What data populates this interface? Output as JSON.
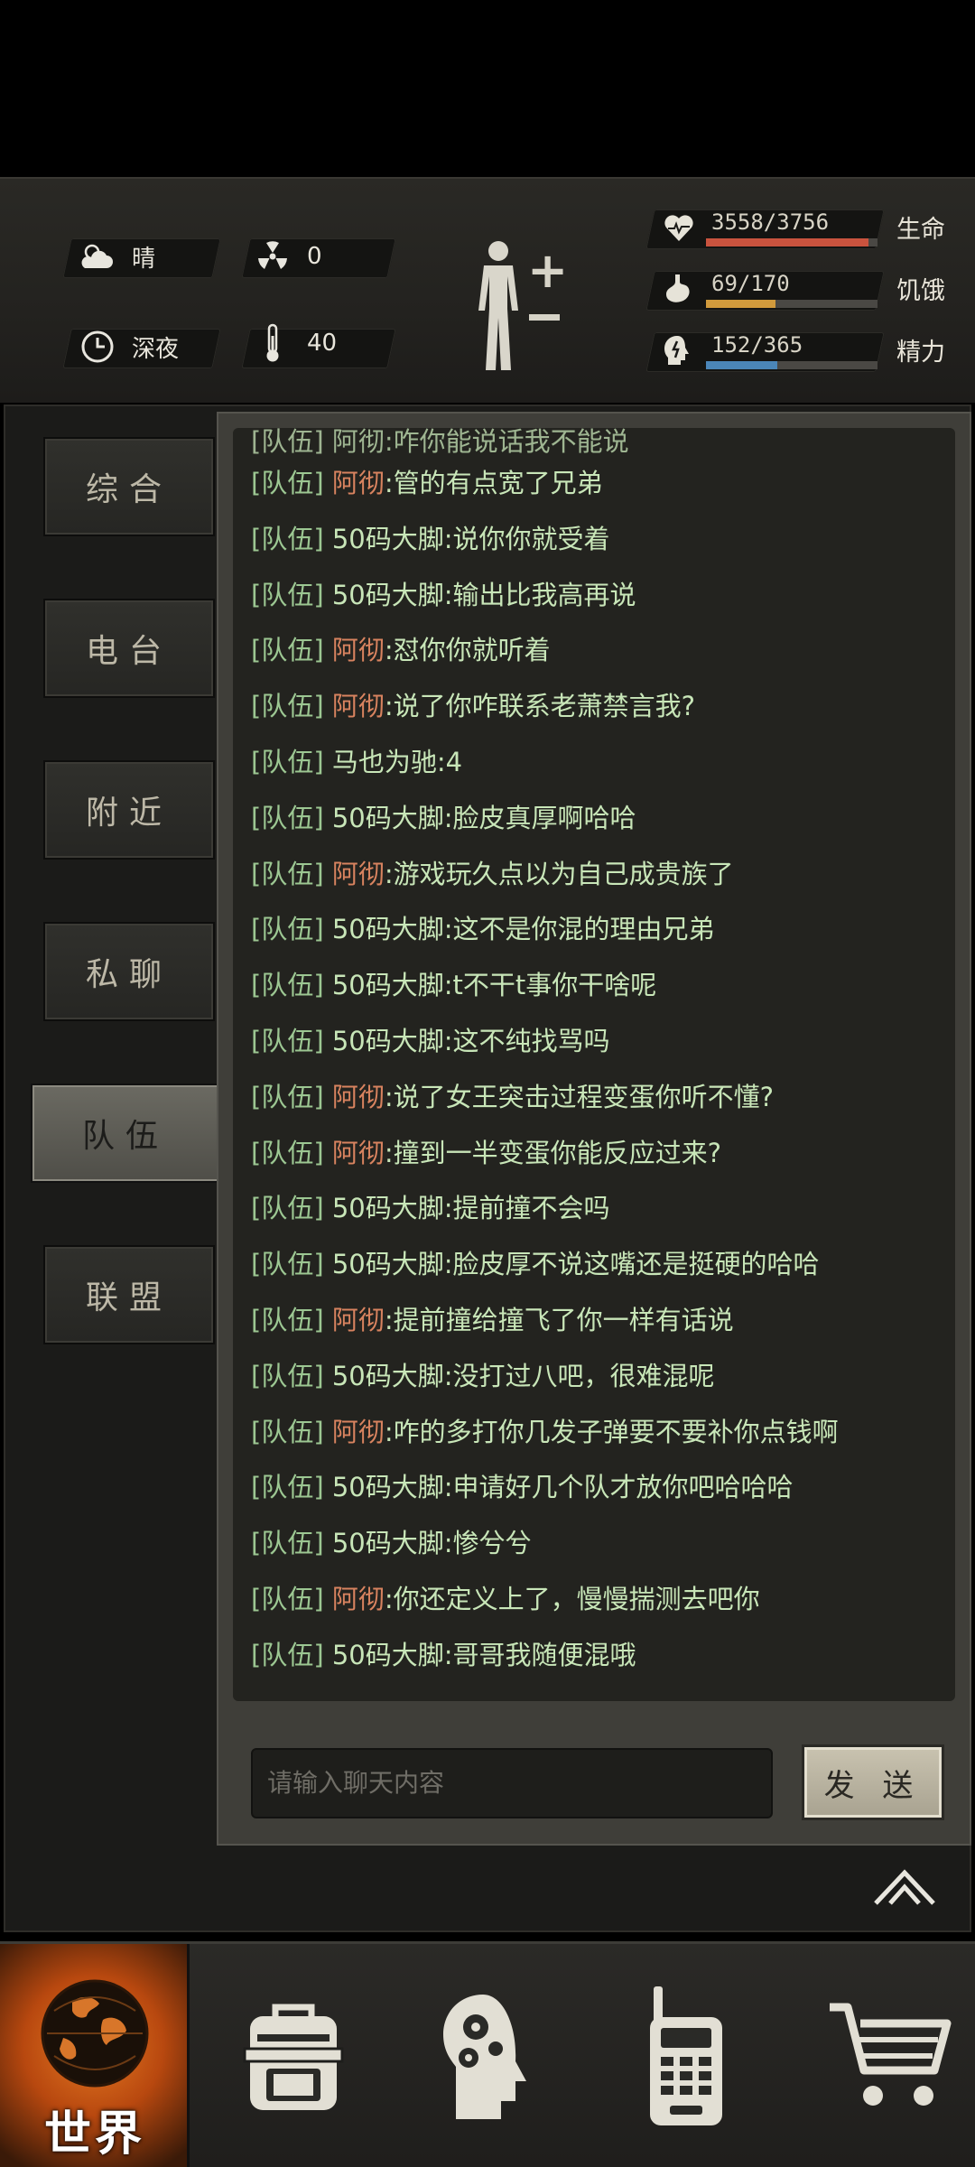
{
  "status": {
    "weather": "晴",
    "radiation": "0",
    "time_of_day": "深夜",
    "temperature": "40",
    "life": {
      "label": "生命",
      "value": "3558/3756",
      "fraction": 0.947,
      "color": "#c9533e"
    },
    "hunger": {
      "label": "饥饿",
      "value": "69/170",
      "fraction": 0.406,
      "color": "#d19a3c"
    },
    "energy": {
      "label": "精力",
      "value": "152/365",
      "fraction": 0.416,
      "color": "#4b86b8"
    }
  },
  "tabs": [
    {
      "label": "综合",
      "active": false
    },
    {
      "label": "电台",
      "active": false
    },
    {
      "label": "附近",
      "active": false
    },
    {
      "label": "私聊",
      "active": false
    },
    {
      "label": "队伍",
      "active": true
    },
    {
      "label": "联盟",
      "active": false
    }
  ],
  "chat": {
    "partial_top": "[队伍] 阿彻:咋你能说话我不能说",
    "messages": [
      {
        "channel": "[队伍]",
        "sender": "阿彻",
        "highlight": true,
        "text": "管的有点宽了兄弟"
      },
      {
        "channel": "[队伍]",
        "sender": "50码大脚",
        "highlight": false,
        "text": "说你你就受着"
      },
      {
        "channel": "[队伍]",
        "sender": "50码大脚",
        "highlight": false,
        "text": "输出比我高再说"
      },
      {
        "channel": "[队伍]",
        "sender": "阿彻",
        "highlight": true,
        "text": "怼你你就听着"
      },
      {
        "channel": "[队伍]",
        "sender": "阿彻",
        "highlight": true,
        "text": "说了你咋联系老萧禁言我?"
      },
      {
        "channel": "[队伍]",
        "sender": "马也为驰",
        "highlight": false,
        "text": "4"
      },
      {
        "channel": "[队伍]",
        "sender": "50码大脚",
        "highlight": false,
        "text": "脸皮真厚啊哈哈"
      },
      {
        "channel": "[队伍]",
        "sender": "阿彻",
        "highlight": true,
        "text": "游戏玩久点以为自己成贵族了"
      },
      {
        "channel": "[队伍]",
        "sender": "50码大脚",
        "highlight": false,
        "text": "这不是你混的理由兄弟"
      },
      {
        "channel": "[队伍]",
        "sender": "50码大脚",
        "highlight": false,
        "text": "t不干t事你干啥呢"
      },
      {
        "channel": "[队伍]",
        "sender": "50码大脚",
        "highlight": false,
        "text": "这不纯找骂吗"
      },
      {
        "channel": "[队伍]",
        "sender": "阿彻",
        "highlight": true,
        "text": "说了女王突击过程变蛋你听不懂?"
      },
      {
        "channel": "[队伍]",
        "sender": "阿彻",
        "highlight": true,
        "text": "撞到一半变蛋你能反应过来?"
      },
      {
        "channel": "[队伍]",
        "sender": "50码大脚",
        "highlight": false,
        "text": "提前撞不会吗"
      },
      {
        "channel": "[队伍]",
        "sender": "50码大脚",
        "highlight": false,
        "text": "脸皮厚不说这嘴还是挺硬的哈哈"
      },
      {
        "channel": "[队伍]",
        "sender": "阿彻",
        "highlight": true,
        "text": "提前撞给撞飞了你一样有话说"
      },
      {
        "channel": "[队伍]",
        "sender": "50码大脚",
        "highlight": false,
        "text": "没打过八吧，很难混呢"
      },
      {
        "channel": "[队伍]",
        "sender": "阿彻",
        "highlight": true,
        "text": "咋的多打你几发子弹要不要补你点钱啊"
      },
      {
        "channel": "[队伍]",
        "sender": "50码大脚",
        "highlight": false,
        "text": "申请好几个队才放你吧哈哈哈"
      },
      {
        "channel": "[队伍]",
        "sender": "50码大脚",
        "highlight": false,
        "text": "惨兮兮"
      },
      {
        "channel": "[队伍]",
        "sender": "阿彻",
        "highlight": true,
        "text": "你还定义上了，慢慢揣测去吧你"
      },
      {
        "channel": "[队伍]",
        "sender": "50码大脚",
        "highlight": false,
        "text": "哥哥我随便混哦"
      }
    ],
    "input_placeholder": "请输入聊天内容",
    "send_label": "发 送"
  },
  "nav": {
    "world_label": "世界",
    "items": [
      "globe-icon",
      "backpack-icon",
      "head-gears-icon",
      "radio-icon",
      "cart-icon"
    ]
  }
}
